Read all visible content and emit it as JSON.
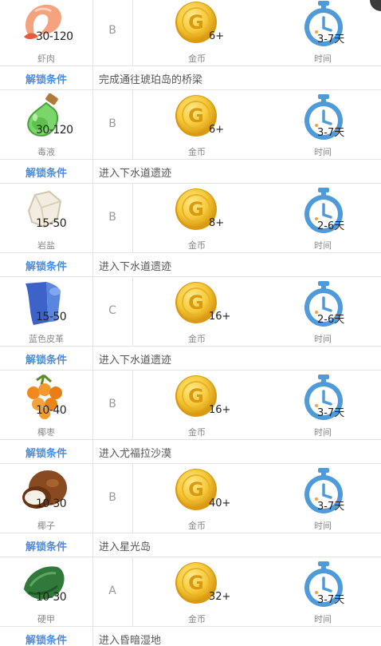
{
  "labels": {
    "coin": "金币",
    "time": "时间",
    "unlock": "解锁条件"
  },
  "items": [
    {
      "name": "虾肉",
      "qty": "30-120",
      "grade": "B",
      "coins": "6+",
      "time": "3-7天",
      "condition": "完成通往琥珀岛的桥梁",
      "icon": "shrimp-icon"
    },
    {
      "name": "毒液",
      "qty": "30-120",
      "grade": "B",
      "coins": "6+",
      "time": "3-7天",
      "condition": "进入下水道遗迹",
      "icon": "poison-bottle-icon"
    },
    {
      "name": "岩盐",
      "qty": "15-50",
      "grade": "B",
      "coins": "8+",
      "time": "2-6天",
      "condition": "进入下水道遗迹",
      "icon": "rock-salt-icon"
    },
    {
      "name": "蓝色皮革",
      "qty": "15-50",
      "grade": "C",
      "coins": "16+",
      "time": "2-6天",
      "condition": "进入下水道遗迹",
      "icon": "blue-leather-icon"
    },
    {
      "name": "椰枣",
      "qty": "10-40",
      "grade": "B",
      "coins": "16+",
      "time": "3-7天",
      "condition": "进入尤福拉沙漠",
      "icon": "dates-icon"
    },
    {
      "name": "椰子",
      "qty": "10-30",
      "grade": "B",
      "coins": "40+",
      "time": "3-7天",
      "condition": "进入星光岛",
      "icon": "coconut-icon"
    },
    {
      "name": "硬甲",
      "qty": "10-30",
      "grade": "A",
      "coins": "32+",
      "time": "3-7天",
      "condition": "进入昏暗湿地",
      "icon": "hard-shell-icon"
    }
  ]
}
